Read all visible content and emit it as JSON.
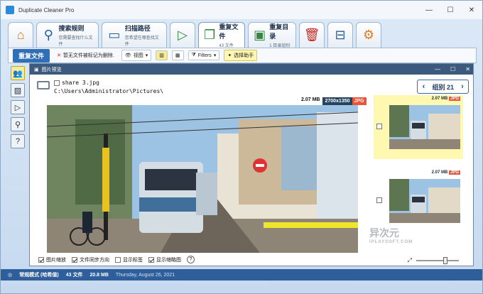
{
  "window": {
    "title": "Duplicate Cleaner Pro",
    "min": "—",
    "max": "☐",
    "close": "✕"
  },
  "ribbon": {
    "tabs": [
      {
        "name": "home",
        "icon": "home-icon",
        "glyph": "⌂"
      },
      {
        "name": "search-rules",
        "icon": "search-icon",
        "glyph": "🔍",
        "title": "搜索规则",
        "sub": "您需要查找什么文件"
      },
      {
        "name": "scan-path",
        "icon": "folder-icon",
        "glyph": "📁",
        "title": "扫描路径",
        "sub": "您希望在哪查找文件"
      },
      {
        "name": "start",
        "icon": "play-icon",
        "glyph": "▷"
      },
      {
        "name": "duplicate-files",
        "icon": "duplicate-files-icon",
        "glyph": "📑",
        "title": "重复文件",
        "sub": "43 文件"
      },
      {
        "name": "duplicate-folders",
        "icon": "duplicate-folder-icon",
        "glyph": "📂",
        "title": "重复目录",
        "sub": "1 目录组别"
      },
      {
        "name": "delete",
        "icon": "trash-icon",
        "glyph": "🗑"
      },
      {
        "name": "toolbox",
        "icon": "toolbox-icon",
        "glyph": "🧰"
      },
      {
        "name": "settings",
        "icon": "gear-icon",
        "glyph": "⚙"
      }
    ]
  },
  "toolbar": {
    "primary": "重复文件",
    "unmarked": "暂无文件被标记为删除.",
    "view": "视图",
    "filters": "Filters",
    "wizard": "选择助手"
  },
  "preview": {
    "title": "图片预览",
    "file_name": "share 3.jpg",
    "file_path": "C:\\Users\\Administrator\\Pictures\\",
    "size": "2.07 MB",
    "dimensions": "2700x1350",
    "format": "JPG",
    "group_label": "组别 21",
    "thumbs": [
      {
        "size": "2.07 MB",
        "format": "JPG"
      },
      {
        "size": "2.07 MB",
        "format": "JPG"
      }
    ],
    "options": [
      "图片缩放",
      "文件同步方向",
      "显示标签",
      "显示缩略图"
    ],
    "watermark": "异次元",
    "watermark_sub": "IPLAYSOFT.COM"
  },
  "status": {
    "mode": "常规模式 (哈希值)",
    "files": "43 文件",
    "size": "20.8 MB",
    "date": "Thursday, August 26, 2021"
  }
}
